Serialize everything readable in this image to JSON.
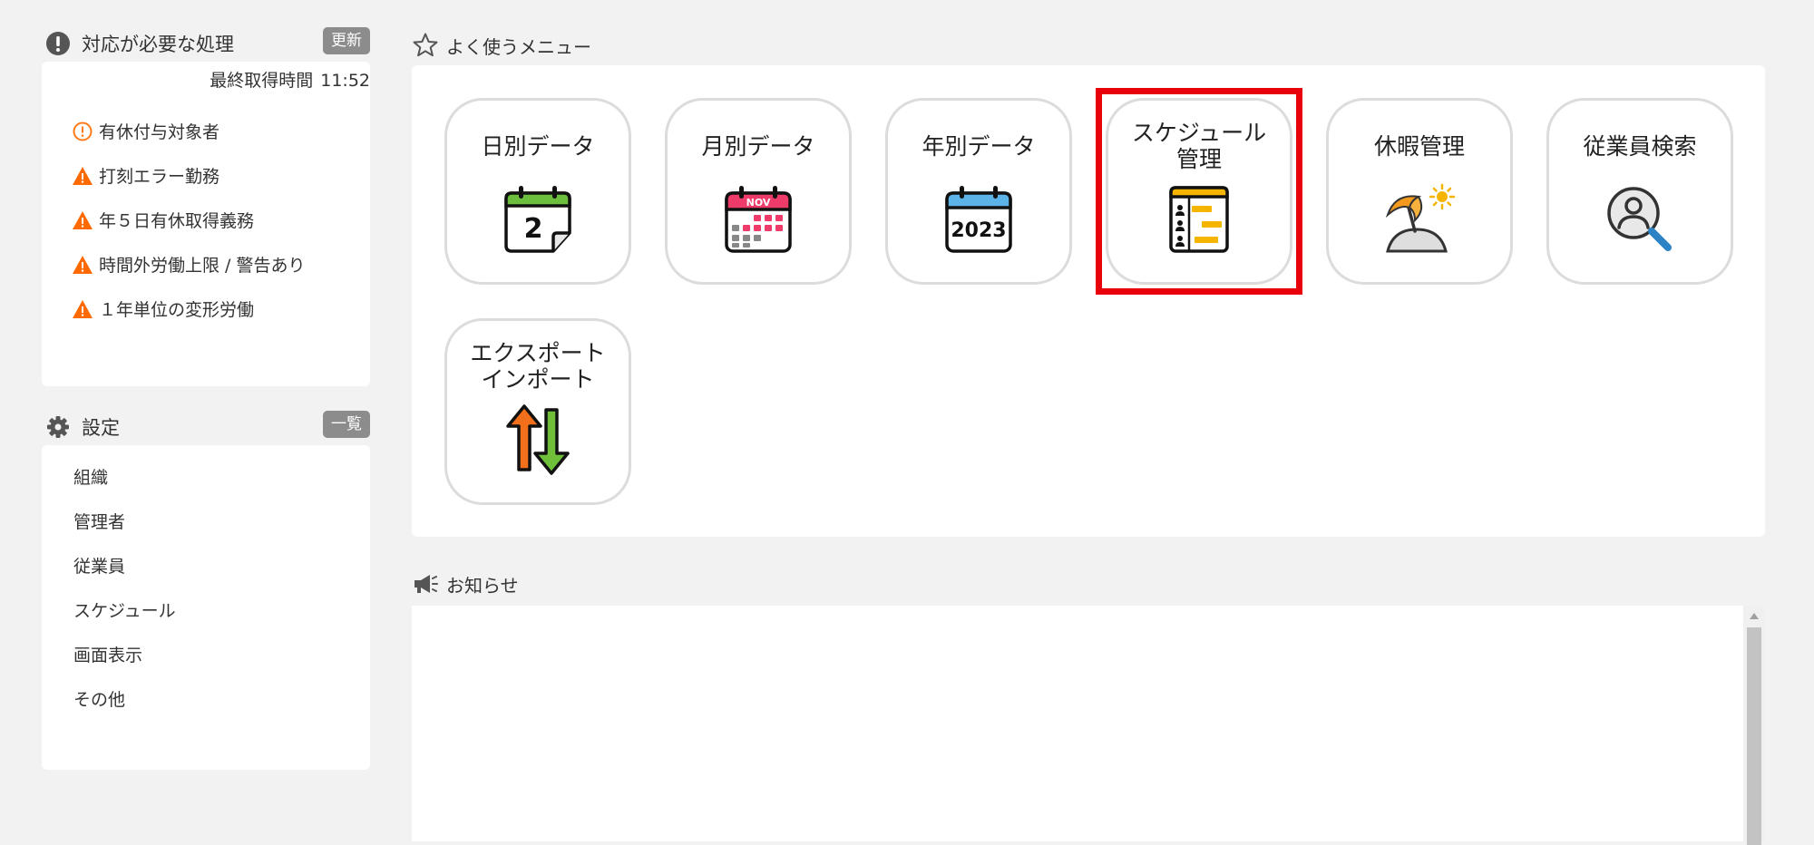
{
  "action_panel": {
    "title": "対応が必要な処理",
    "refresh_label": "更新",
    "last_fetched_label": "最終取得時間",
    "last_fetched_time": "11:52",
    "items": [
      {
        "label": "有休付与対象者",
        "icon": "info-circle-icon"
      },
      {
        "label": "打刻エラー勤務",
        "icon": "warning-triangle-icon"
      },
      {
        "label": "年５日有休取得義務",
        "icon": "warning-triangle-icon"
      },
      {
        "label": "時間外労働上限 / 警告あり",
        "icon": "warning-triangle-icon"
      },
      {
        "label": "１年単位の変形労働",
        "icon": "warning-triangle-icon"
      }
    ]
  },
  "settings_panel": {
    "title": "設定",
    "list_label": "一覧",
    "items": [
      "組織",
      "管理者",
      "従業員",
      "スケジュール",
      "画面表示",
      "その他"
    ]
  },
  "favorites": {
    "title": "よく使うメニュー",
    "tiles": [
      {
        "label": "日別データ",
        "icon": "daily-calendar-icon"
      },
      {
        "label": "月別データ",
        "icon": "monthly-calendar-icon",
        "month_text": "NOV"
      },
      {
        "label": "年別データ",
        "icon": "yearly-calendar-icon",
        "year_text": "2023"
      },
      {
        "label": "スケジュール\n管理",
        "icon": "schedule-chart-icon",
        "highlighted": true
      },
      {
        "label": "休暇管理",
        "icon": "beach-umbrella-icon"
      },
      {
        "label": "従業員検索",
        "icon": "user-search-icon"
      },
      {
        "label": "エクスポート\nインポート",
        "icon": "export-import-arrows-icon"
      }
    ]
  },
  "notices": {
    "title": "お知らせ"
  },
  "colors": {
    "highlight": "#e8000b",
    "warning": "#ff6a00",
    "badge_bg": "#8c8c8c"
  }
}
